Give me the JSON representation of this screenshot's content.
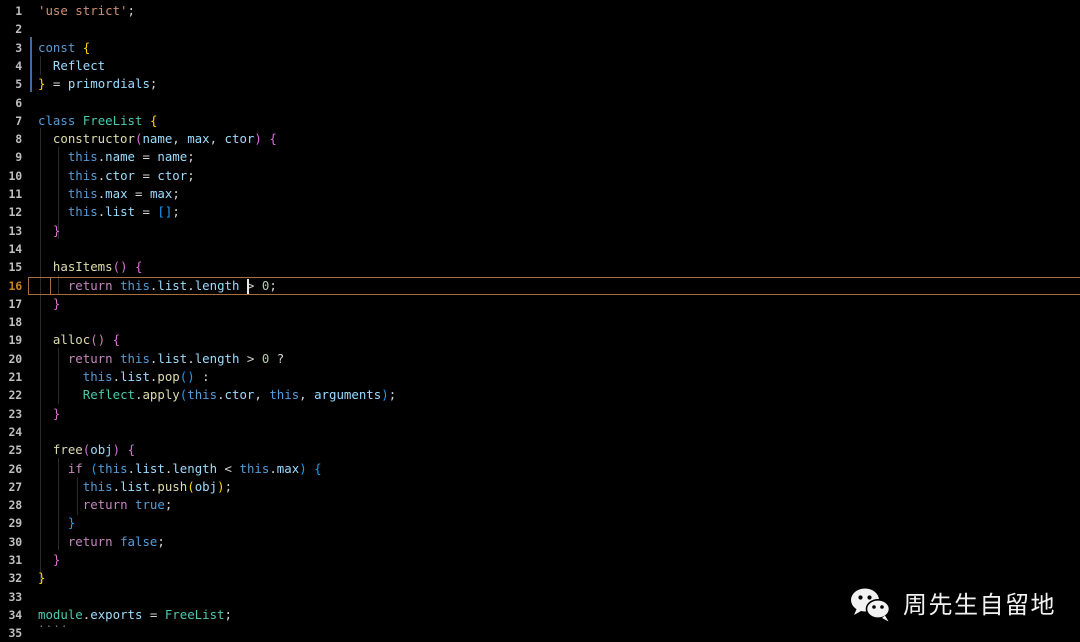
{
  "editor": {
    "background_color": "#000000",
    "foreground_color": "#d4d4d4",
    "active_line_number": 16,
    "active_line_border_color": "#a86f3d",
    "active_line_number_color": "#c8821e",
    "cursor_color": "#e8e8e8",
    "total_lines": 35,
    "language": "javascript",
    "fold_marker": "...."
  },
  "line_numbers": [
    "1",
    "2",
    "3",
    "4",
    "5",
    "6",
    "7",
    "8",
    "9",
    "10",
    "11",
    "12",
    "13",
    "14",
    "15",
    "16",
    "17",
    "18",
    "19",
    "20",
    "21",
    "22",
    "23",
    "24",
    "25",
    "26",
    "27",
    "28",
    "29",
    "30",
    "31",
    "32",
    "33",
    "34",
    "35"
  ],
  "code_lines": [
    "'use strict';",
    "",
    "const {",
    "  Reflect",
    "} = primordials;",
    "",
    "class FreeList {",
    "  constructor(name, max, ctor) {",
    "    this.name = name;",
    "    this.ctor = ctor;",
    "    this.max = max;",
    "    this.list = [];",
    "  }",
    "",
    "  hasItems() {",
    "    return this.list.length > 0;",
    "  }",
    "",
    "  alloc() {",
    "    return this.list.length > 0 ?",
    "      this.list.pop() :",
    "      Reflect.apply(this.ctor, this, arguments);",
    "  }",
    "",
    "  free(obj) {",
    "    if (this.list.length < this.max) {",
    "      this.list.push(obj);",
    "      return true;",
    "    }",
    "    return false;",
    "  }",
    "}",
    "",
    "module.exports = FreeList;",
    ""
  ],
  "tokens": [
    [
      [
        "'use strict'",
        "t-str"
      ],
      [
        ";",
        "t-punc"
      ]
    ],
    [],
    [
      [
        "const",
        "t-kw"
      ],
      [
        " ",
        "t-punc"
      ],
      [
        "{",
        "t-br-y"
      ]
    ],
    [
      [
        "  ",
        "t-punc"
      ],
      [
        "Reflect",
        "t-var"
      ]
    ],
    [
      [
        "}",
        "t-br-y"
      ],
      [
        " = ",
        "t-punc"
      ],
      [
        "primordials",
        "t-var"
      ],
      [
        ";",
        "t-punc"
      ]
    ],
    [],
    [
      [
        "class",
        "t-kw"
      ],
      [
        " ",
        "t-punc"
      ],
      [
        "FreeList",
        "t-cls"
      ],
      [
        " ",
        "t-punc"
      ],
      [
        "{",
        "t-br-y"
      ]
    ],
    [
      [
        "  ",
        "t-punc"
      ],
      [
        "constructor",
        "t-fn"
      ],
      [
        "(",
        "t-br-p"
      ],
      [
        "name",
        "t-var"
      ],
      [
        ", ",
        "t-punc"
      ],
      [
        "max",
        "t-var"
      ],
      [
        ", ",
        "t-punc"
      ],
      [
        "ctor",
        "t-var"
      ],
      [
        ")",
        "t-br-p"
      ],
      [
        " ",
        "t-punc"
      ],
      [
        "{",
        "t-br-p"
      ]
    ],
    [
      [
        "    ",
        "t-punc"
      ],
      [
        "this",
        "t-kw"
      ],
      [
        ".",
        "t-punc"
      ],
      [
        "name",
        "t-var"
      ],
      [
        " = ",
        "t-punc"
      ],
      [
        "name",
        "t-var"
      ],
      [
        ";",
        "t-punc"
      ]
    ],
    [
      [
        "    ",
        "t-punc"
      ],
      [
        "this",
        "t-kw"
      ],
      [
        ".",
        "t-punc"
      ],
      [
        "ctor",
        "t-var"
      ],
      [
        " = ",
        "t-punc"
      ],
      [
        "ctor",
        "t-var"
      ],
      [
        ";",
        "t-punc"
      ]
    ],
    [
      [
        "    ",
        "t-punc"
      ],
      [
        "this",
        "t-kw"
      ],
      [
        ".",
        "t-punc"
      ],
      [
        "max",
        "t-var"
      ],
      [
        " = ",
        "t-punc"
      ],
      [
        "max",
        "t-var"
      ],
      [
        ";",
        "t-punc"
      ]
    ],
    [
      [
        "    ",
        "t-punc"
      ],
      [
        "this",
        "t-kw"
      ],
      [
        ".",
        "t-punc"
      ],
      [
        "list",
        "t-var"
      ],
      [
        " = ",
        "t-punc"
      ],
      [
        "[",
        "t-br-b"
      ],
      [
        "]",
        "t-br-b"
      ],
      [
        ";",
        "t-punc"
      ]
    ],
    [
      [
        "  ",
        "t-punc"
      ],
      [
        "}",
        "t-br-p"
      ]
    ],
    [],
    [
      [
        "  ",
        "t-punc"
      ],
      [
        "hasItems",
        "t-fn"
      ],
      [
        "(",
        "t-br-p"
      ],
      [
        ")",
        "t-br-p"
      ],
      [
        " ",
        "t-punc"
      ],
      [
        "{",
        "t-br-p"
      ]
    ],
    [
      [
        "    ",
        "t-punc"
      ],
      [
        "return",
        "t-ctrl"
      ],
      [
        " ",
        "t-punc"
      ],
      [
        "this",
        "t-kw"
      ],
      [
        ".",
        "t-punc"
      ],
      [
        "list",
        "t-var"
      ],
      [
        ".",
        "t-punc"
      ],
      [
        "length",
        "t-var"
      ],
      [
        " > ",
        "t-punc"
      ],
      [
        "0",
        "t-num"
      ],
      [
        ";",
        "t-punc"
      ]
    ],
    [
      [
        "  ",
        "t-punc"
      ],
      [
        "}",
        "t-br-p"
      ]
    ],
    [],
    [
      [
        "  ",
        "t-punc"
      ],
      [
        "alloc",
        "t-fn"
      ],
      [
        "(",
        "t-br-p"
      ],
      [
        ")",
        "t-br-p"
      ],
      [
        " ",
        "t-punc"
      ],
      [
        "{",
        "t-br-p"
      ]
    ],
    [
      [
        "    ",
        "t-punc"
      ],
      [
        "return",
        "t-ctrl"
      ],
      [
        " ",
        "t-punc"
      ],
      [
        "this",
        "t-kw"
      ],
      [
        ".",
        "t-punc"
      ],
      [
        "list",
        "t-var"
      ],
      [
        ".",
        "t-punc"
      ],
      [
        "length",
        "t-var"
      ],
      [
        " > ",
        "t-punc"
      ],
      [
        "0",
        "t-num"
      ],
      [
        " ?",
        "t-punc"
      ]
    ],
    [
      [
        "      ",
        "t-punc"
      ],
      [
        "this",
        "t-kw"
      ],
      [
        ".",
        "t-punc"
      ],
      [
        "list",
        "t-var"
      ],
      [
        ".",
        "t-punc"
      ],
      [
        "pop",
        "t-fn"
      ],
      [
        "(",
        "t-br-b"
      ],
      [
        ")",
        "t-br-b"
      ],
      [
        " :",
        "t-punc"
      ]
    ],
    [
      [
        "      ",
        "t-punc"
      ],
      [
        "Reflect",
        "t-cls"
      ],
      [
        ".",
        "t-punc"
      ],
      [
        "apply",
        "t-fn"
      ],
      [
        "(",
        "t-br-b"
      ],
      [
        "this",
        "t-kw"
      ],
      [
        ".",
        "t-punc"
      ],
      [
        "ctor",
        "t-var"
      ],
      [
        ", ",
        "t-punc"
      ],
      [
        "this",
        "t-kw"
      ],
      [
        ", ",
        "t-punc"
      ],
      [
        "arguments",
        "t-var"
      ],
      [
        ")",
        "t-br-b"
      ],
      [
        ";",
        "t-punc"
      ]
    ],
    [
      [
        "  ",
        "t-punc"
      ],
      [
        "}",
        "t-br-p"
      ]
    ],
    [],
    [
      [
        "  ",
        "t-punc"
      ],
      [
        "free",
        "t-fn"
      ],
      [
        "(",
        "t-br-p"
      ],
      [
        "obj",
        "t-var"
      ],
      [
        ")",
        "t-br-p"
      ],
      [
        " ",
        "t-punc"
      ],
      [
        "{",
        "t-br-p"
      ]
    ],
    [
      [
        "    ",
        "t-punc"
      ],
      [
        "if",
        "t-ctrl"
      ],
      [
        " ",
        "t-punc"
      ],
      [
        "(",
        "t-br-b"
      ],
      [
        "this",
        "t-kw"
      ],
      [
        ".",
        "t-punc"
      ],
      [
        "list",
        "t-var"
      ],
      [
        ".",
        "t-punc"
      ],
      [
        "length",
        "t-var"
      ],
      [
        " < ",
        "t-punc"
      ],
      [
        "this",
        "t-kw"
      ],
      [
        ".",
        "t-punc"
      ],
      [
        "max",
        "t-var"
      ],
      [
        ")",
        "t-br-b"
      ],
      [
        " ",
        "t-punc"
      ],
      [
        "{",
        "t-br-b"
      ]
    ],
    [
      [
        "      ",
        "t-punc"
      ],
      [
        "this",
        "t-kw"
      ],
      [
        ".",
        "t-punc"
      ],
      [
        "list",
        "t-var"
      ],
      [
        ".",
        "t-punc"
      ],
      [
        "push",
        "t-fn"
      ],
      [
        "(",
        "t-br-y"
      ],
      [
        "obj",
        "t-var"
      ],
      [
        ")",
        "t-br-y"
      ],
      [
        ";",
        "t-punc"
      ]
    ],
    [
      [
        "      ",
        "t-punc"
      ],
      [
        "return",
        "t-ctrl"
      ],
      [
        " ",
        "t-punc"
      ],
      [
        "true",
        "t-const"
      ],
      [
        ";",
        "t-punc"
      ]
    ],
    [
      [
        "    ",
        "t-punc"
      ],
      [
        "}",
        "t-br-b"
      ]
    ],
    [
      [
        "    ",
        "t-punc"
      ],
      [
        "return",
        "t-ctrl"
      ],
      [
        " ",
        "t-punc"
      ],
      [
        "false",
        "t-const"
      ],
      [
        ";",
        "t-punc"
      ]
    ],
    [
      [
        "  ",
        "t-punc"
      ],
      [
        "}",
        "t-br-p"
      ]
    ],
    [
      [
        "}",
        "t-br-y"
      ]
    ],
    [],
    [
      [
        "module",
        "t-cls"
      ],
      [
        ".",
        "t-punc"
      ],
      [
        "exports",
        "t-var"
      ],
      [
        " = ",
        "t-punc"
      ],
      [
        "FreeList",
        "t-cls"
      ],
      [
        ";",
        "t-punc"
      ]
    ],
    []
  ],
  "watermark": {
    "text": "周先生自留地",
    "logo_name": "wechat-logo",
    "text_color": "#f2f2f2"
  }
}
